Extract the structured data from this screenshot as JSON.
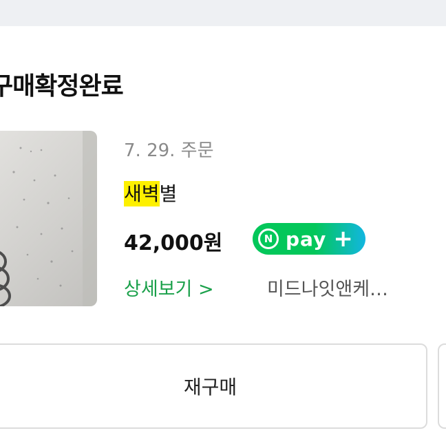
{
  "order": {
    "status_title": "구매확정완료",
    "date": "7. 29. 주문",
    "product_name_highlight": "새벽",
    "product_name_rest": "별",
    "price": "42,000원",
    "npay": {
      "badge": "N",
      "label": "pay",
      "plus": "+"
    },
    "detail_link": "상세보기 >",
    "seller": "미드나잇앤케…"
  },
  "actions": {
    "reorder_label": "재구매"
  },
  "colors": {
    "accent_green": "#1aa04a",
    "npay_green": "#03c75a",
    "npay_blue": "#12b6e0",
    "highlight_yellow": "#fdf000"
  }
}
